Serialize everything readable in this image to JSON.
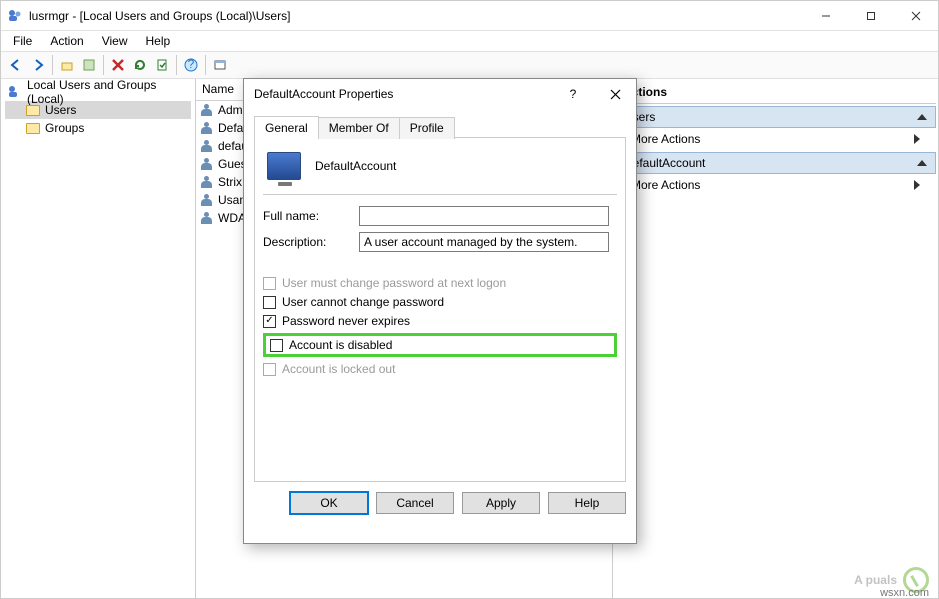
{
  "window": {
    "title": "lusrmgr - [Local Users and Groups (Local)\\Users]"
  },
  "menu": {
    "file": "File",
    "action": "Action",
    "view": "View",
    "help": "Help"
  },
  "tree": {
    "root": "Local Users and Groups (Local)",
    "users": "Users",
    "groups": "Groups"
  },
  "list": {
    "header_name": "Name",
    "rows": {
      "0": "Administrator",
      "1": "DefaultAccount",
      "2": "defaultuser0",
      "3": "Guest",
      "4": "Strix",
      "5": "Usama Jawad",
      "6": "WDAGUtilityAccount"
    }
  },
  "actions": {
    "title": "Actions",
    "band_users": "Users",
    "more_actions": "More Actions",
    "band_account": "DefaultAccount",
    "more_actions2": "More Actions"
  },
  "dialog": {
    "title": "DefaultAccount Properties",
    "tabs": {
      "general": "General",
      "member_of": "Member Of",
      "profile": "Profile"
    },
    "account_name": "DefaultAccount",
    "labels": {
      "full_name": "Full name:",
      "description": "Description:",
      "must_change": "User must change password at next logon",
      "cannot_change": "User cannot change password",
      "never_expires": "Password never expires",
      "disabled": "Account is disabled",
      "locked": "Account is locked out"
    },
    "values": {
      "full_name": "",
      "description": "A user account managed by the system."
    },
    "buttons": {
      "ok": "OK",
      "cancel": "Cancel",
      "apply": "Apply",
      "help": "Help"
    }
  },
  "watermark": {
    "text": "A  puals",
    "site": "wsxn.com"
  }
}
